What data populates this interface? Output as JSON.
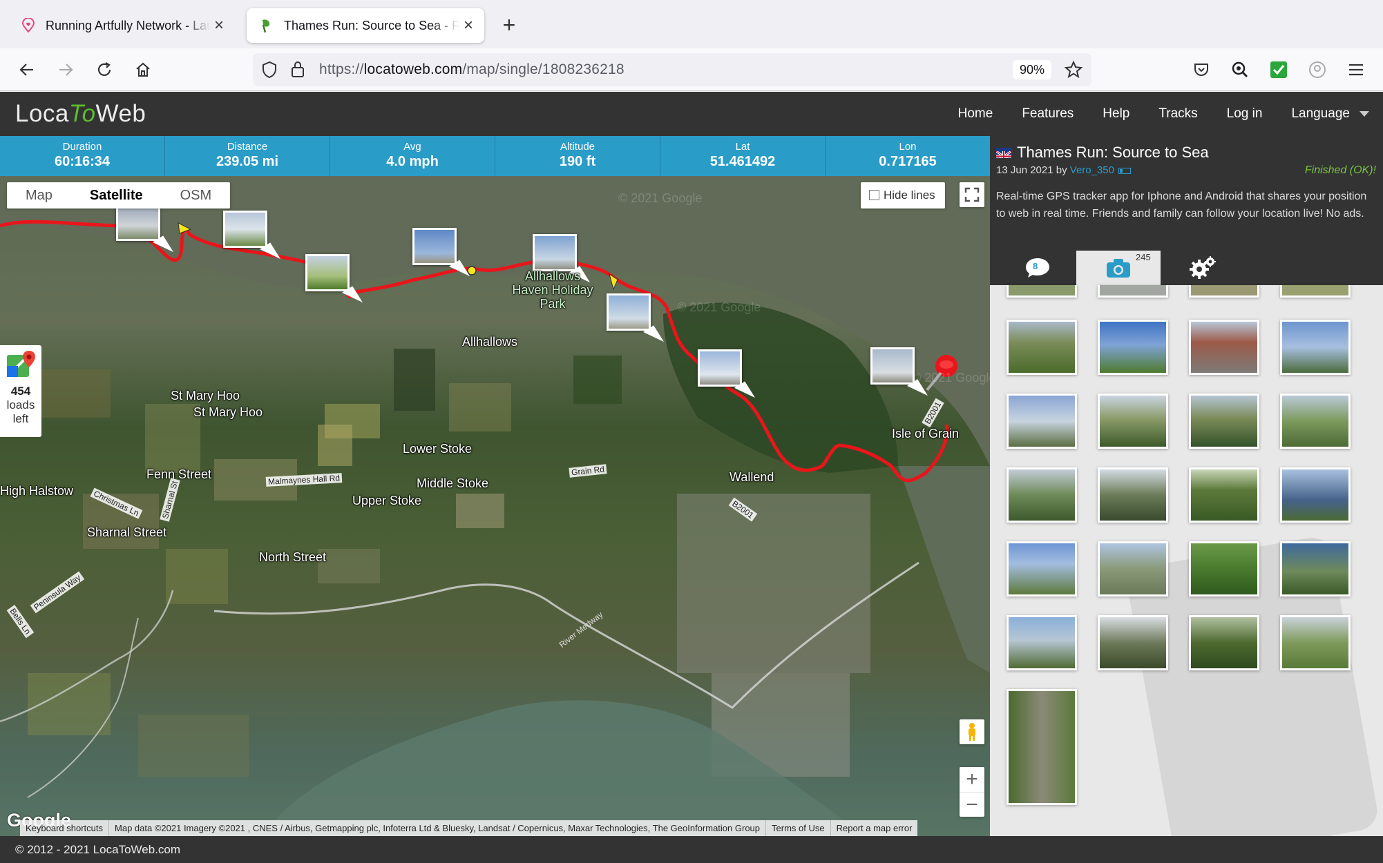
{
  "browser": {
    "tabs": [
      {
        "title": "Running Artfully Network - Launch",
        "active": false
      },
      {
        "title": "Thames Run: Source to Sea - Real-time",
        "active": true
      }
    ],
    "url": {
      "scheme": "https://",
      "host": "locatoweb.com",
      "path": "/map/single/1808236218"
    },
    "zoom": "90%"
  },
  "site": {
    "logo": {
      "a": "Loca",
      "b": "To",
      "c": "Web"
    },
    "menu": [
      "Home",
      "Features",
      "Help",
      "Tracks",
      "Log in",
      "Language"
    ]
  },
  "stats": [
    {
      "label": "Duration",
      "value": "60:16:34"
    },
    {
      "label": "Distance",
      "value": "239.05 mi"
    },
    {
      "label": "Avg",
      "value": "4.0 mph"
    },
    {
      "label": "Altitude",
      "value": "190 ft"
    },
    {
      "label": "Lat",
      "value": "51.461492"
    },
    {
      "label": "Lon",
      "value": "0.717165"
    }
  ],
  "map": {
    "types": [
      "Map",
      "Satellite",
      "OSM"
    ],
    "selected_type": "Satellite",
    "hide_lines": "Hide lines",
    "loads": {
      "count": "454",
      "line1": "loads",
      "line2": "left"
    },
    "places": [
      {
        "name": "Allhallows Haven Holiday Park"
      },
      {
        "name": "Allhallows"
      },
      {
        "name": "St Mary Hoo"
      },
      {
        "name": "St Mary Hoo"
      },
      {
        "name": "Lower Stoke"
      },
      {
        "name": "Fenn Street"
      },
      {
        "name": "Middle Stoke"
      },
      {
        "name": "Upper Stoke"
      },
      {
        "name": "Wallend"
      },
      {
        "name": "Isle of Grain"
      },
      {
        "name": "High Halstow"
      },
      {
        "name": "Sharnal Street"
      },
      {
        "name": "North Street"
      }
    ],
    "roads": [
      "Malmaynes Hall Rd",
      "Grain Rd",
      "B2001",
      "Christmas Ln",
      "Sharnal St",
      "Peninsula Way",
      "Bells Ln",
      "River Medway",
      "B2001"
    ],
    "watermark": "© 2021 Google",
    "google_logo": "Google",
    "attribution": [
      "Keyboard shortcuts",
      "Map data ©2021 Imagery ©2021 , CNES / Airbus, Getmapping plc, Infoterra Ltd & Bluesky, Landsat / Copernicus, Maxar Technologies, The GeoInformation Group",
      "Terms of Use",
      "Report a map error"
    ],
    "zoom_in": "+",
    "zoom_out": "−"
  },
  "panel": {
    "title": "Thames Run: Source to Sea",
    "date": "13 Jun 2021",
    "by": "by",
    "user": "Vero_350",
    "status": "Finished (OK)!",
    "description": "Real-time GPS tracker app for Iphone and Android that shares your position to web in real time. Friends and family can follow your location live! No ads.",
    "comments_count": "8",
    "photos_count": "245"
  },
  "footer": "© 2012 - 2021 LocaToWeb.com",
  "colors": {
    "stats_bar": "#2a9cc8",
    "header": "#333333",
    "track": "#e8161b",
    "logo_accent": "#5cbd2e",
    "finished": "#76c442"
  }
}
